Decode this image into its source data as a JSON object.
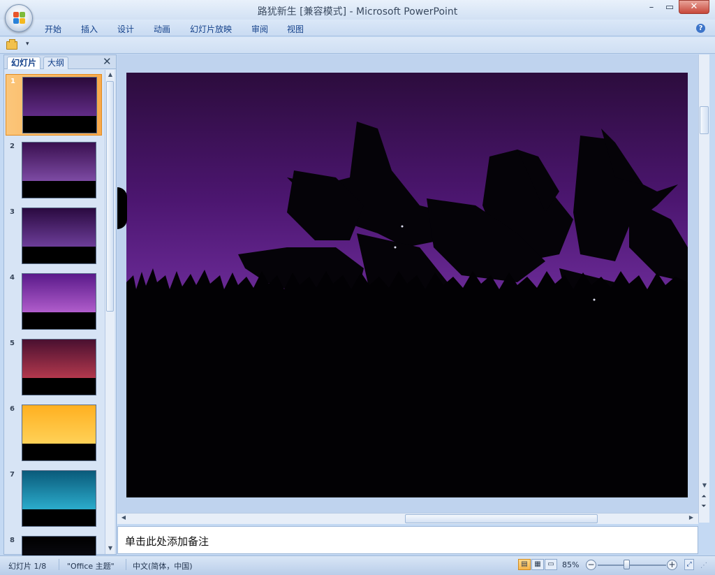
{
  "window": {
    "title": "路犹新生 [兼容模式] - Microsoft PowerPoint",
    "minimize": "–",
    "maximize": "▭",
    "close": "✕"
  },
  "ribbon": {
    "tabs": [
      "开始",
      "插入",
      "设计",
      "动画",
      "幻灯片放映",
      "审阅",
      "视图"
    ],
    "help": "?"
  },
  "qat": {
    "dropdown": "▾"
  },
  "pane": {
    "tabs": [
      "幻灯片",
      "大纲"
    ],
    "close": "✕",
    "selected_index": 0,
    "slides": [
      {
        "num": "1",
        "top": "#2a0a3a",
        "bottom": "#7a3aa8",
        "theme": "birds"
      },
      {
        "num": "2",
        "top": "#3a1050",
        "bottom": "#9a64c8",
        "theme": "clouds"
      },
      {
        "num": "3",
        "top": "#2a0a40",
        "bottom": "#8a54c0",
        "theme": "tree"
      },
      {
        "num": "4",
        "top": "#5a1a8a",
        "bottom": "#d67ae8",
        "theme": "moon"
      },
      {
        "num": "5",
        "top": "#4a1030",
        "bottom": "#e04a5a",
        "theme": "sunset"
      },
      {
        "num": "6",
        "top": "#ffb020",
        "bottom": "#ffe070",
        "theme": "yellow"
      },
      {
        "num": "7",
        "top": "#0a5a7a",
        "bottom": "#3ad0f0",
        "theme": "cyan"
      },
      {
        "num": "8",
        "top": "#000000",
        "bottom": "#1a1a2a",
        "theme": "dark"
      }
    ]
  },
  "notes": {
    "placeholder": "单击此处添加备注"
  },
  "status": {
    "slide_info": "幻灯片 1/8",
    "theme": "\"Office 主题\"",
    "language": "中文(简体，中国)",
    "zoom": "85%",
    "zoom_minus": "−",
    "zoom_plus": "+"
  }
}
